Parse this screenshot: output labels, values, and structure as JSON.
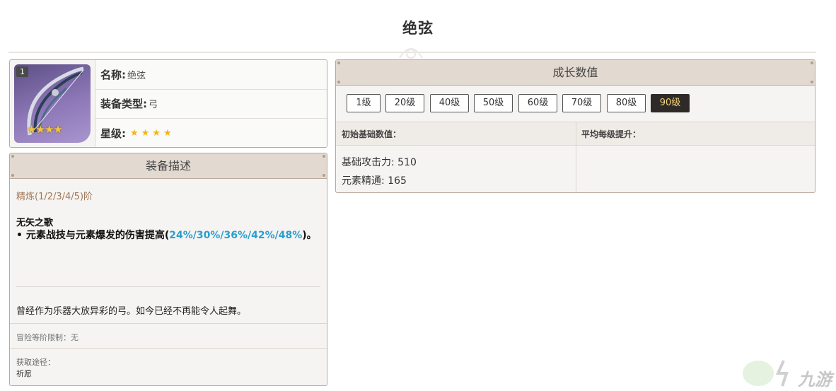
{
  "page": {
    "title": "绝弦"
  },
  "weapon": {
    "rank_badge": "1",
    "thumb_stars": "★★★★",
    "fields": [
      {
        "key": "名称:",
        "value": "绝弦"
      },
      {
        "key": "装备类型:",
        "value": "弓"
      },
      {
        "key": "星级:",
        "stars": "★★★★",
        "rarity": 4
      }
    ]
  },
  "description": {
    "header": "装备描述",
    "refine_label": "精炼(1/2/3/4/5)阶",
    "passive_name": "无矢之歌",
    "passive_prefix": "• 元素战技与元素爆发的伤害提高(",
    "passive_values": "24%/30%/36%/42%/48%",
    "passive_suffix": ")。",
    "flavor": "曾经作为乐器大放异彩的弓。如今已经不再能令人起舞。",
    "ar_limit": "冒险等阶限制：无",
    "obtain_label": "获取途径：",
    "obtain_value": "祈愿"
  },
  "growth": {
    "header": "成长数值",
    "levels": [
      "1级",
      "20级",
      "40级",
      "50级",
      "60级",
      "70级",
      "80级",
      "90级"
    ],
    "active_level": "90级",
    "col_base": "初始基础数值：",
    "col_avg": "平均每级提升：",
    "stats": [
      "基础攻击力: 510",
      "元素精通: 165"
    ]
  },
  "colors": {
    "accent_highlight": "#2a9fcf",
    "active_tab_bg": "#2d2a27",
    "active_tab_text": "#f5d47a",
    "panel_border": "#b9a99a",
    "header_bg": "#e2d9d0",
    "refine_label": "#a07858",
    "star": "#f2b41c"
  },
  "watermark": {
    "text": "九游"
  }
}
